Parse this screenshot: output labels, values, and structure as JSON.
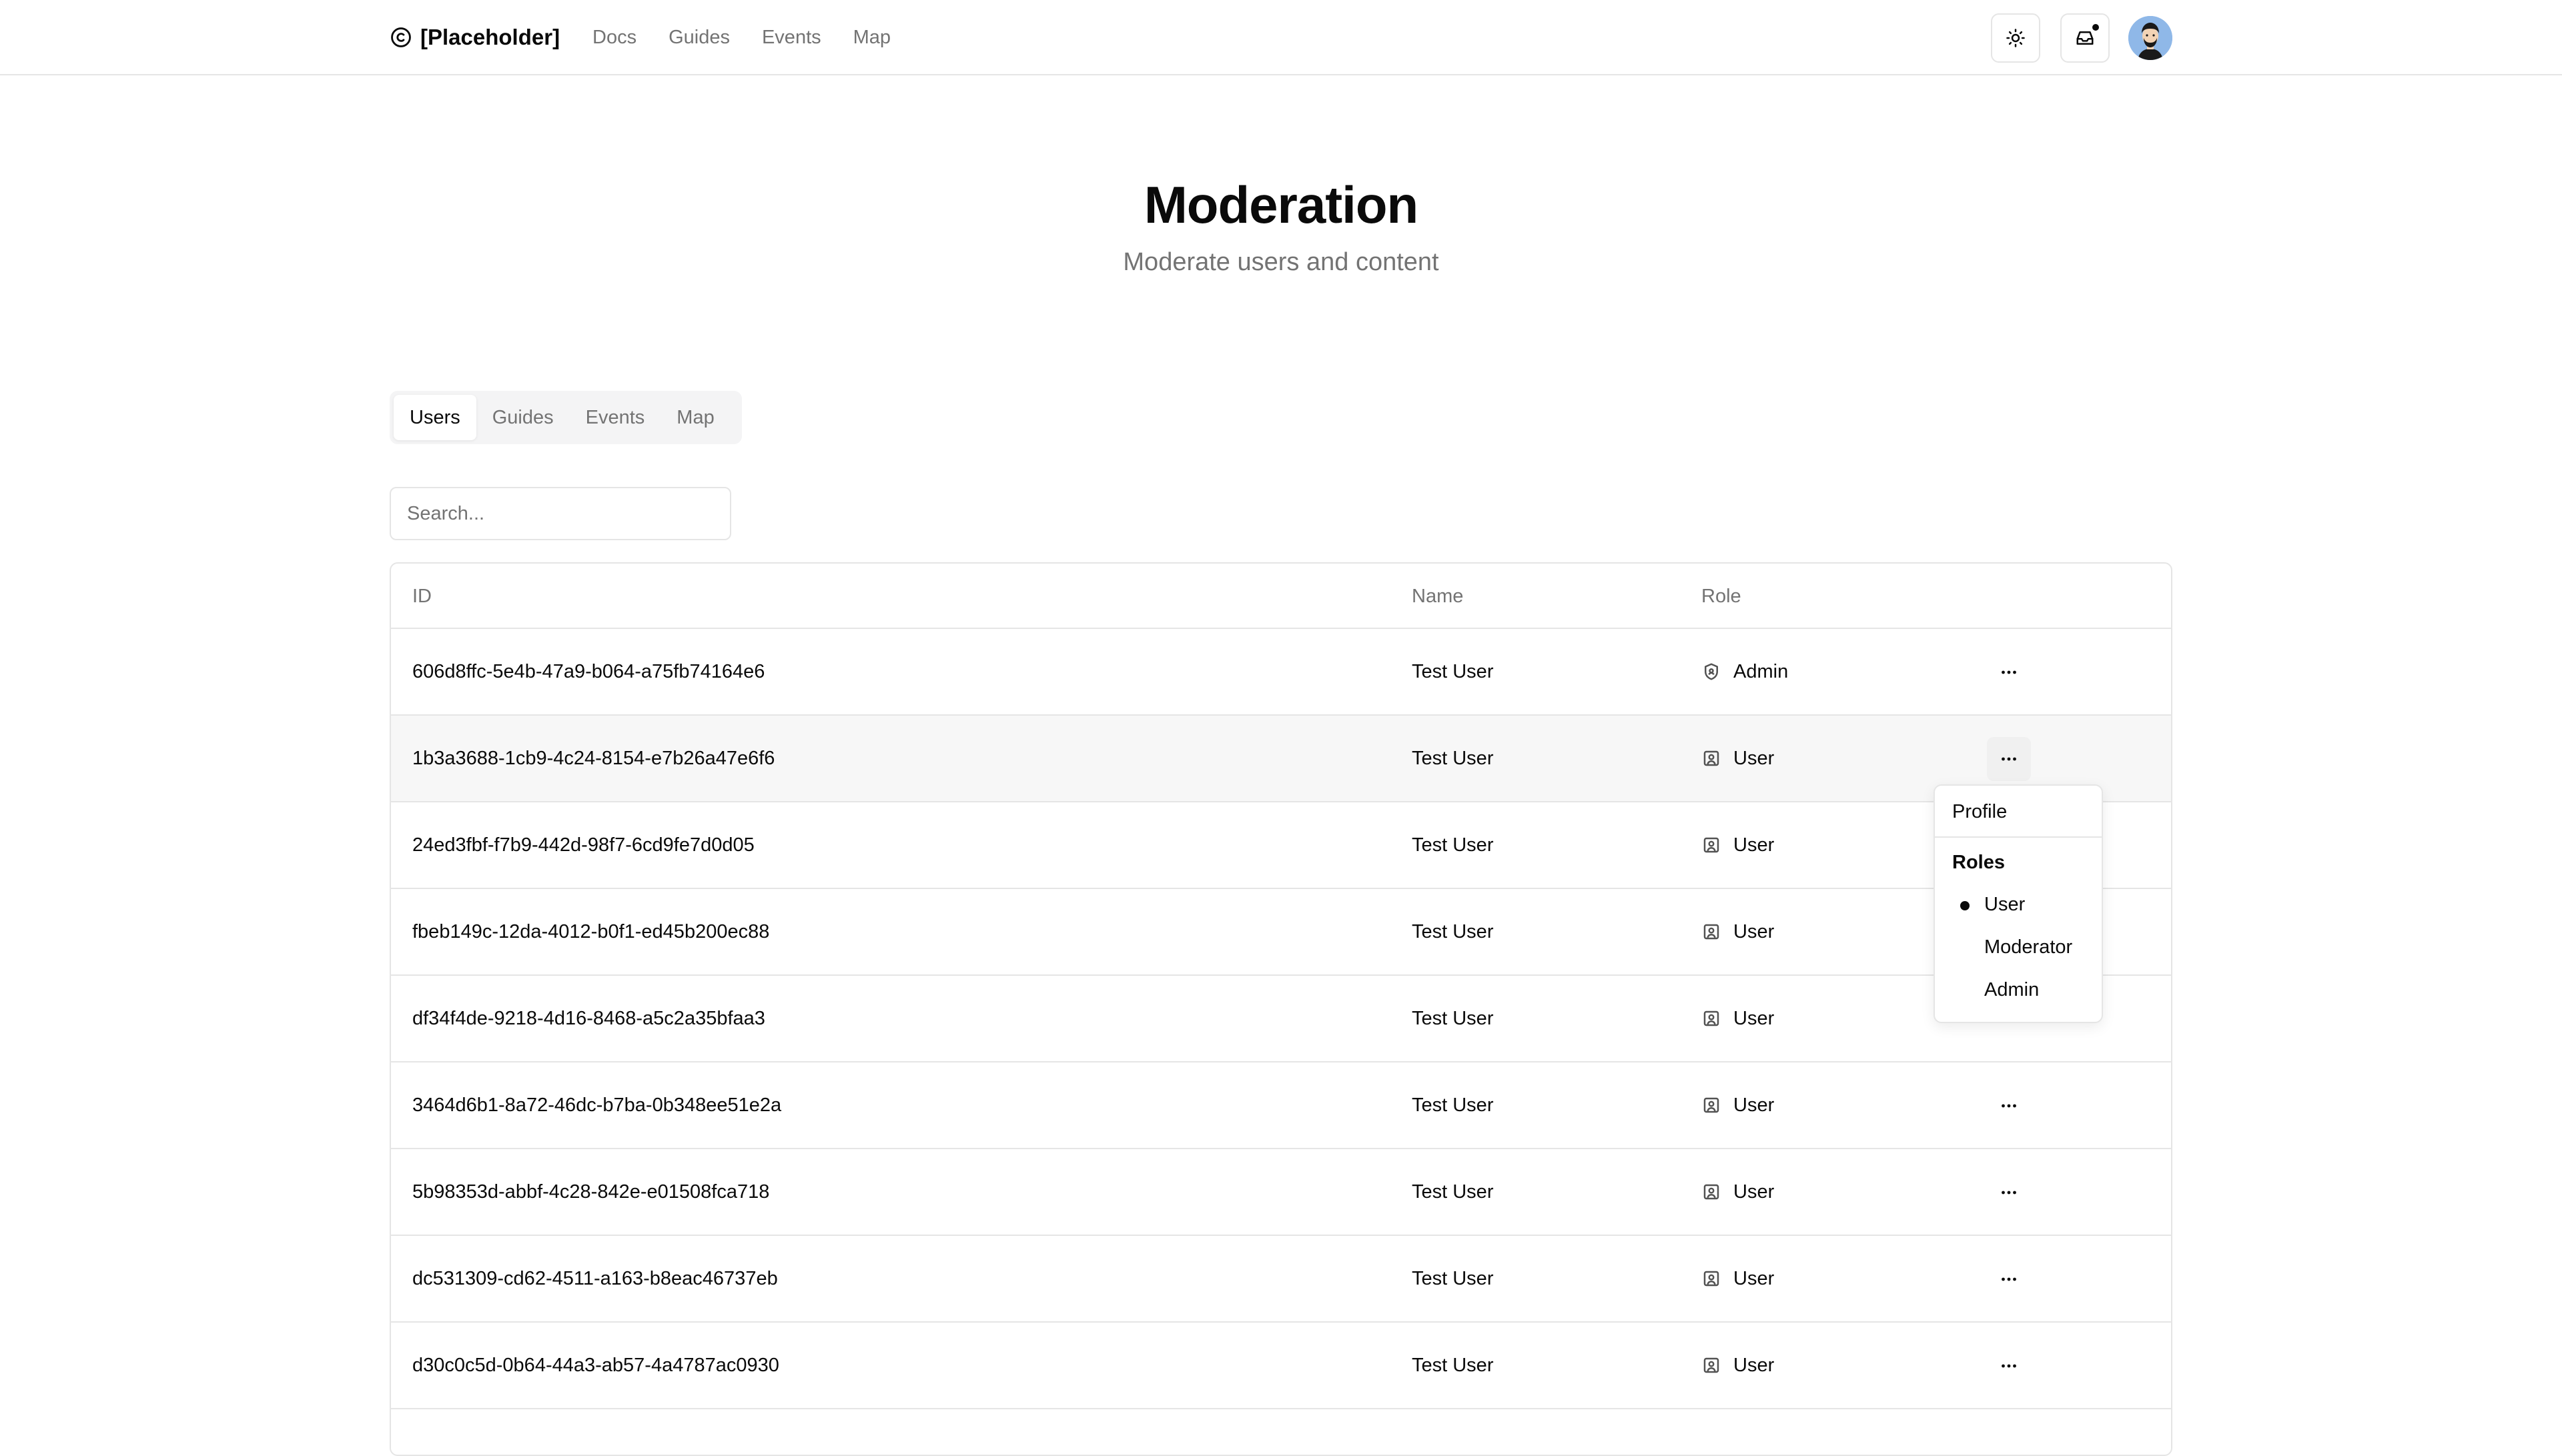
{
  "header": {
    "brand": "[Placeholder]",
    "nav": [
      "Docs",
      "Guides",
      "Events",
      "Map"
    ],
    "theme_toggle_icon": "sun-icon",
    "inbox_icon": "inbox-icon",
    "has_notification": true
  },
  "page": {
    "title": "Moderation",
    "subtitle": "Moderate users and content"
  },
  "tabs": [
    "Users",
    "Guides",
    "Events",
    "Map"
  ],
  "active_tab": "Users",
  "search": {
    "placeholder": "Search...",
    "value": ""
  },
  "table": {
    "columns": [
      "ID",
      "Name",
      "Role"
    ],
    "rows": [
      {
        "id": "606d8ffc-5e4b-47a9-b064-a75fb74164e6",
        "name": "Test User",
        "role": "Admin"
      },
      {
        "id": "1b3a3688-1cb9-4c24-8154-e7b26a47e6f6",
        "name": "Test User",
        "role": "User"
      },
      {
        "id": "24ed3fbf-f7b9-442d-98f7-6cd9fe7d0d05",
        "name": "Test User",
        "role": "User"
      },
      {
        "id": "fbeb149c-12da-4012-b0f1-ed45b200ec88",
        "name": "Test User",
        "role": "User"
      },
      {
        "id": "df34f4de-9218-4d16-8468-a5c2a35bfaa3",
        "name": "Test User",
        "role": "User"
      },
      {
        "id": "3464d6b1-8a72-46dc-b7ba-0b348ee51e2a",
        "name": "Test User",
        "role": "User"
      },
      {
        "id": "5b98353d-abbf-4c28-842e-e01508fca718",
        "name": "Test User",
        "role": "User"
      },
      {
        "id": "dc531309-cd62-4511-a163-b8eac46737eb",
        "name": "Test User",
        "role": "User"
      },
      {
        "id": "d30c0c5d-0b64-44a3-ab57-4a4787ac0930",
        "name": "Test User",
        "role": "User"
      }
    ]
  },
  "dropdown": {
    "profile": "Profile",
    "roles_label": "Roles",
    "roles": [
      "User",
      "Moderator",
      "Admin"
    ],
    "selected_role": "User"
  }
}
